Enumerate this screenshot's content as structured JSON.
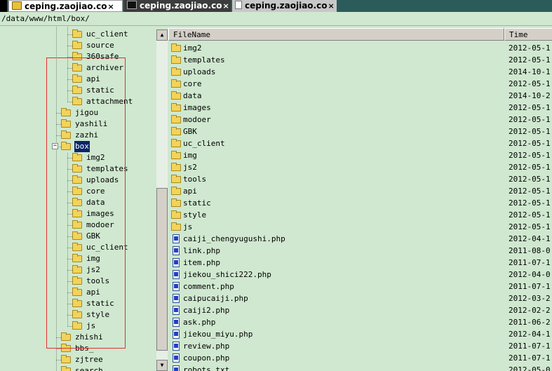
{
  "tabs": [
    {
      "label": "ceping.zaojiao.co",
      "close": "×",
      "icon": "folder-icon"
    },
    {
      "label": "ceping.zaojiao.co",
      "close": "×",
      "icon": "terminal-icon"
    },
    {
      "label": "ceping.zaojiao.co",
      "close": "×",
      "icon": "page-icon"
    }
  ],
  "path": "/data/www/html/box/",
  "tree": {
    "items": [
      "uc_client",
      "source",
      "360safe",
      "archiver",
      "api",
      "static",
      "attachment",
      "jigou",
      "yashili",
      "zazhi",
      "box",
      "img2",
      "templates",
      "uploads",
      "core",
      "data",
      "images",
      "modoer",
      "GBK",
      "uc_client",
      "img",
      "js2",
      "tools",
      "api",
      "static",
      "style",
      "js",
      "zhishi",
      "bbs_",
      "zjtree",
      "search"
    ],
    "selected": "box",
    "collapse_glyph": "−"
  },
  "scroll": {
    "up": "▲",
    "down": "▼"
  },
  "list": {
    "columns": {
      "name": "FileName",
      "time": "Time"
    },
    "rows": [
      {
        "name": "img2",
        "time": "2012-05-1",
        "type": "folder"
      },
      {
        "name": "templates",
        "time": "2012-05-1",
        "type": "folder"
      },
      {
        "name": "uploads",
        "time": "2014-10-1",
        "type": "folder"
      },
      {
        "name": "core",
        "time": "2012-05-1",
        "type": "folder"
      },
      {
        "name": "data",
        "time": "2014-10-2",
        "type": "folder"
      },
      {
        "name": "images",
        "time": "2012-05-1",
        "type": "folder"
      },
      {
        "name": "modoer",
        "time": "2012-05-1",
        "type": "folder"
      },
      {
        "name": "GBK",
        "time": "2012-05-1",
        "type": "folder"
      },
      {
        "name": "uc_client",
        "time": "2012-05-1",
        "type": "folder"
      },
      {
        "name": "img",
        "time": "2012-05-1",
        "type": "folder"
      },
      {
        "name": "js2",
        "time": "2012-05-1",
        "type": "folder"
      },
      {
        "name": "tools",
        "time": "2012-05-1",
        "type": "folder"
      },
      {
        "name": "api",
        "time": "2012-05-1",
        "type": "folder"
      },
      {
        "name": "static",
        "time": "2012-05-1",
        "type": "folder"
      },
      {
        "name": "style",
        "time": "2012-05-1",
        "type": "folder"
      },
      {
        "name": "js",
        "time": "2012-05-1",
        "type": "folder"
      },
      {
        "name": "caiji_chengyugushi.php",
        "time": "2012-04-1",
        "type": "file"
      },
      {
        "name": "link.php",
        "time": "2011-08-0",
        "type": "file"
      },
      {
        "name": "item.php",
        "time": "2011-07-1",
        "type": "file"
      },
      {
        "name": "jiekou_shici222.php",
        "time": "2012-04-0",
        "type": "file"
      },
      {
        "name": "comment.php",
        "time": "2011-07-1",
        "type": "file"
      },
      {
        "name": "caipucaiji.php",
        "time": "2012-03-2",
        "type": "file"
      },
      {
        "name": "caiji2.php",
        "time": "2012-02-2",
        "type": "file"
      },
      {
        "name": "ask.php",
        "time": "2011-06-2",
        "type": "file"
      },
      {
        "name": "jiekou_miyu.php",
        "time": "2012-04-1",
        "type": "file"
      },
      {
        "name": "review.php",
        "time": "2011-07-1",
        "type": "file"
      },
      {
        "name": "coupon.php",
        "time": "2011-07-1",
        "type": "file"
      },
      {
        "name": "robots.txt",
        "time": "2012-05-0",
        "type": "file"
      }
    ]
  }
}
